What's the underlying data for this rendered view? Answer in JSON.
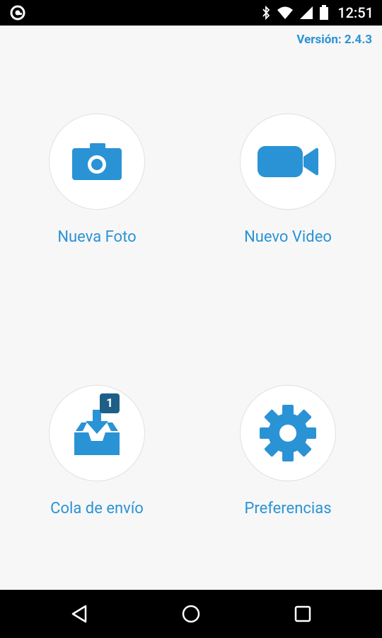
{
  "status_bar": {
    "time": "12:51",
    "icons": [
      "app-logo-icon",
      "bluetooth-icon",
      "wifi-icon",
      "signal-icon",
      "battery-icon"
    ]
  },
  "version_text": "Versión: 2.4.3",
  "colors": {
    "accent": "#2a93d5",
    "badge": "#1e5f88",
    "background": "#f7f7f7"
  },
  "actions": [
    {
      "label": "Nueva Foto",
      "icon": "camera-icon"
    },
    {
      "label": "Nuevo Video",
      "icon": "video-camera-icon"
    },
    {
      "label": "Cola de envío",
      "icon": "inbox-download-icon",
      "badge": "1"
    },
    {
      "label": "Preferencias",
      "icon": "gear-icon"
    }
  ],
  "nav_bar": {
    "buttons": [
      "back-icon",
      "home-icon",
      "recents-icon"
    ]
  }
}
